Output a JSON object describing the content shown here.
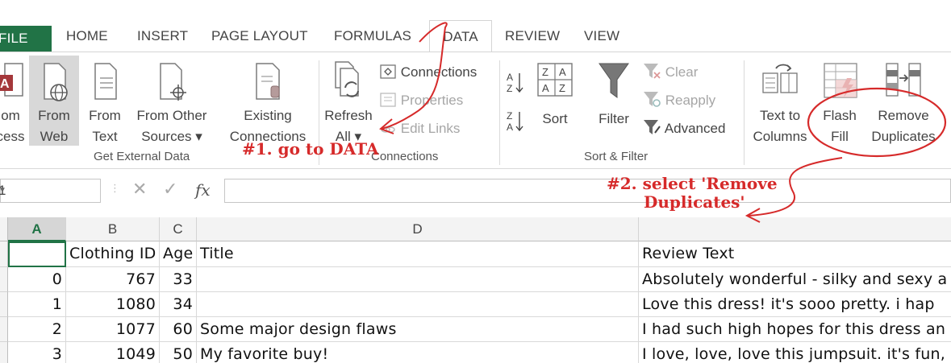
{
  "tabs": {
    "file": "FILE",
    "home": "HOME",
    "insert": "INSERT",
    "page_layout": "PAGE LAYOUT",
    "formulas": "FORMULAS",
    "data": "DATA",
    "review": "REVIEW",
    "view": "VIEW"
  },
  "ribbon": {
    "get_external_data": {
      "from_access": [
        "om",
        "cess"
      ],
      "from_web": [
        "From",
        "Web"
      ],
      "from_text": [
        "From",
        "Text"
      ],
      "from_other": [
        "From Other",
        "Sources ▾"
      ],
      "existing": [
        "Existing",
        "Connections"
      ],
      "label": "Get External Data"
    },
    "connections": {
      "refresh": [
        "Refresh",
        "All ▾"
      ],
      "connections": "Connections",
      "properties": "Properties",
      "edit_links": "Edit Links",
      "label": "Connections"
    },
    "sort_filter": {
      "sort": "Sort",
      "filter": "Filter",
      "clear": "Clear",
      "reapply": "Reapply",
      "advanced": "Advanced",
      "label": "Sort & Filter"
    },
    "data_tools": {
      "text_to_columns": [
        "Text to",
        "Columns"
      ],
      "flash_fill": [
        "Flash",
        "Fill"
      ],
      "remove_duplicates": [
        "Remove",
        "Duplicates"
      ]
    }
  },
  "formula_bar": {
    "name_box": "1",
    "fx": "fx"
  },
  "grid": {
    "columns": [
      "A",
      "B",
      "C",
      "D",
      ""
    ],
    "header_row": [
      "",
      "Clothing ID",
      "Age",
      "Title",
      "Review Text"
    ],
    "rows": [
      [
        "0",
        "767",
        "33",
        "",
        "Absolutely wonderful - silky and sexy a"
      ],
      [
        "1",
        "1080",
        "34",
        "",
        "Love this dress!  it's sooo pretty.  i hap"
      ],
      [
        "2",
        "1077",
        "60",
        "Some major design flaws",
        "I had such high hopes for this dress an"
      ],
      [
        "3",
        "1049",
        "50",
        "My favorite buy!",
        "I love, love, love this jumpsuit. it's fun,"
      ]
    ]
  },
  "annotations": {
    "step1": "#1. go to DATA",
    "step2_line1": "#2. select 'Remove",
    "step2_line2": "Duplicates'",
    "color": "#d62a2a"
  },
  "colors": {
    "excel_green": "#217346",
    "annotation_red": "#d62a2a"
  }
}
